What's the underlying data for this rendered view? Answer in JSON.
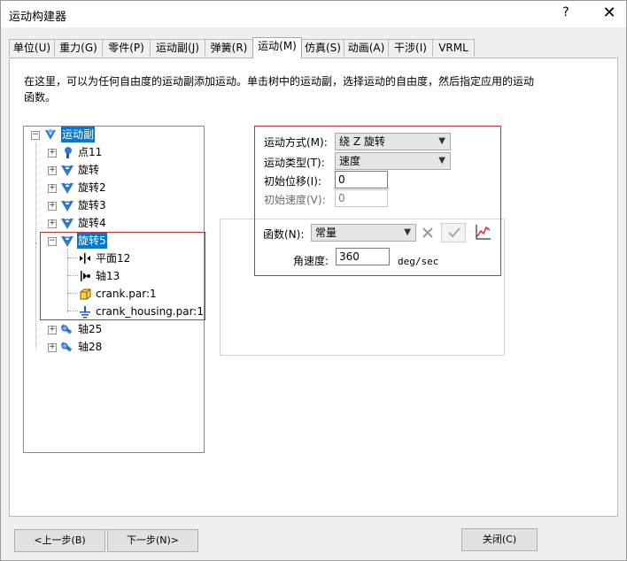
{
  "window": {
    "title": "运动构建器",
    "help": "?",
    "close": "✕"
  },
  "tabs": [
    {
      "label": "单位(U)"
    },
    {
      "label": "重力(G)"
    },
    {
      "label": "零件(P)"
    },
    {
      "label": "运动副(J)"
    },
    {
      "label": "弹簧(R)"
    },
    {
      "label": "运动(M)"
    },
    {
      "label": "仿真(S)"
    },
    {
      "label": "动画(A)"
    },
    {
      "label": "干涉(I)"
    },
    {
      "label": "VRML"
    }
  ],
  "description": "在这里，可以为任何自由度的运动副添加运动。单击树中的运动副，选择运动的自由度，然后指定应用的运动函数。",
  "tree": {
    "root": "运动副",
    "items": [
      {
        "label": "点11"
      },
      {
        "label": "旋转"
      },
      {
        "label": "旋转2"
      },
      {
        "label": "旋转3"
      },
      {
        "label": "旋转4"
      },
      {
        "label": "旋转5"
      },
      {
        "label": "平面12"
      },
      {
        "label": "轴13"
      },
      {
        "label": "crank.par:1"
      },
      {
        "label": "crank_housing.par:1"
      },
      {
        "label": "轴25"
      },
      {
        "label": "轴28"
      }
    ]
  },
  "form": {
    "motion_mode_label": "运动方式(M):",
    "motion_mode_value": "绕 Z 旋转",
    "motion_type_label": "运动类型(T):",
    "motion_type_value": "速度",
    "init_disp_label": "初始位移(I):",
    "init_disp_value": "0",
    "init_vel_label": "初始速度(V):",
    "init_vel_value": "0",
    "function_label": "函数(N):",
    "function_value": "常量",
    "angular_vel_label": "角速度:",
    "angular_vel_value": "360",
    "angular_vel_unit": "deg/sec"
  },
  "buttons": {
    "prev": "<上一步(B)",
    "next": "下一步(N)>",
    "close": "关闭(C)"
  },
  "colors": {
    "selection": "#0078d7",
    "highlight_box": "#e0262b"
  }
}
